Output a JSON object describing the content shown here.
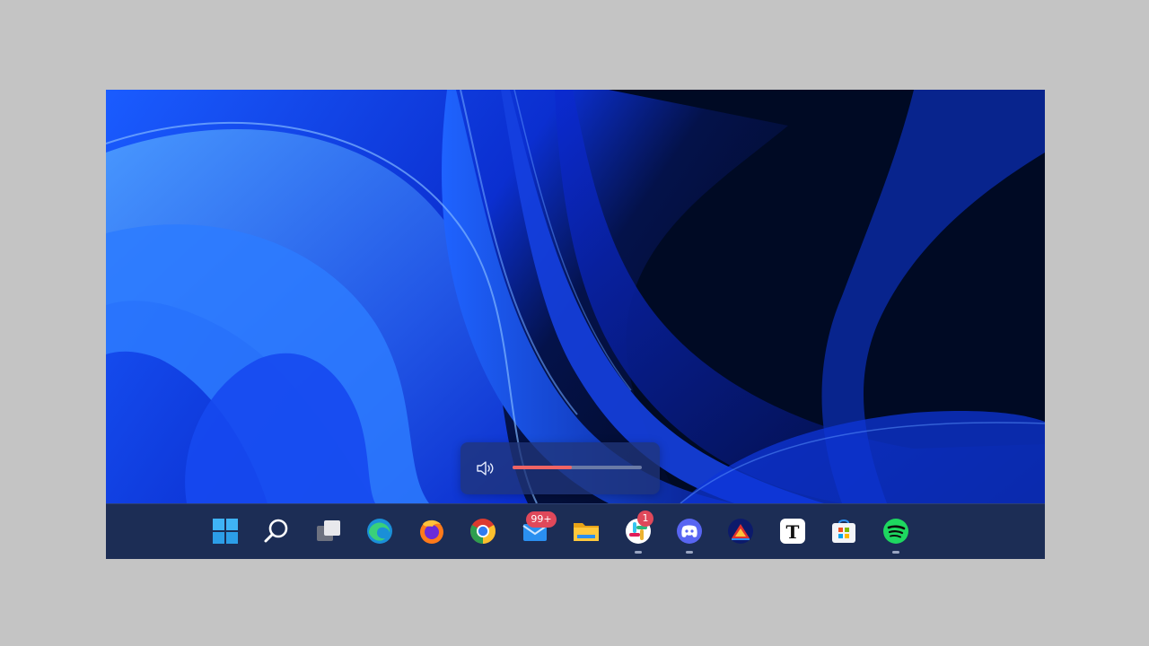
{
  "volume": {
    "level_percent": 46,
    "accent_color": "#f06464",
    "icon": "speaker-icon"
  },
  "taskbar": {
    "items": [
      {
        "name": "start",
        "icon": "windows-logo-icon",
        "running": false
      },
      {
        "name": "search",
        "icon": "search-icon",
        "running": false
      },
      {
        "name": "task-view",
        "icon": "task-view-icon",
        "running": false
      },
      {
        "name": "edge",
        "icon": "edge-icon",
        "running": false
      },
      {
        "name": "firefox",
        "icon": "firefox-icon",
        "running": false
      },
      {
        "name": "chrome",
        "icon": "chrome-icon",
        "running": false
      },
      {
        "name": "mail",
        "icon": "mail-icon",
        "running": false,
        "badge": "99+"
      },
      {
        "name": "file-explorer",
        "icon": "folder-icon",
        "running": false
      },
      {
        "name": "slack",
        "icon": "slack-icon",
        "running": true,
        "badge": "1"
      },
      {
        "name": "discord",
        "icon": "discord-icon",
        "running": true
      },
      {
        "name": "app-tent",
        "icon": "tent-app-icon",
        "running": false
      },
      {
        "name": "typora",
        "icon": "typora-icon",
        "running": false,
        "letter": "T"
      },
      {
        "name": "microsoft-store",
        "icon": "store-icon",
        "running": false
      },
      {
        "name": "spotify",
        "icon": "spotify-icon",
        "running": true
      }
    ]
  }
}
